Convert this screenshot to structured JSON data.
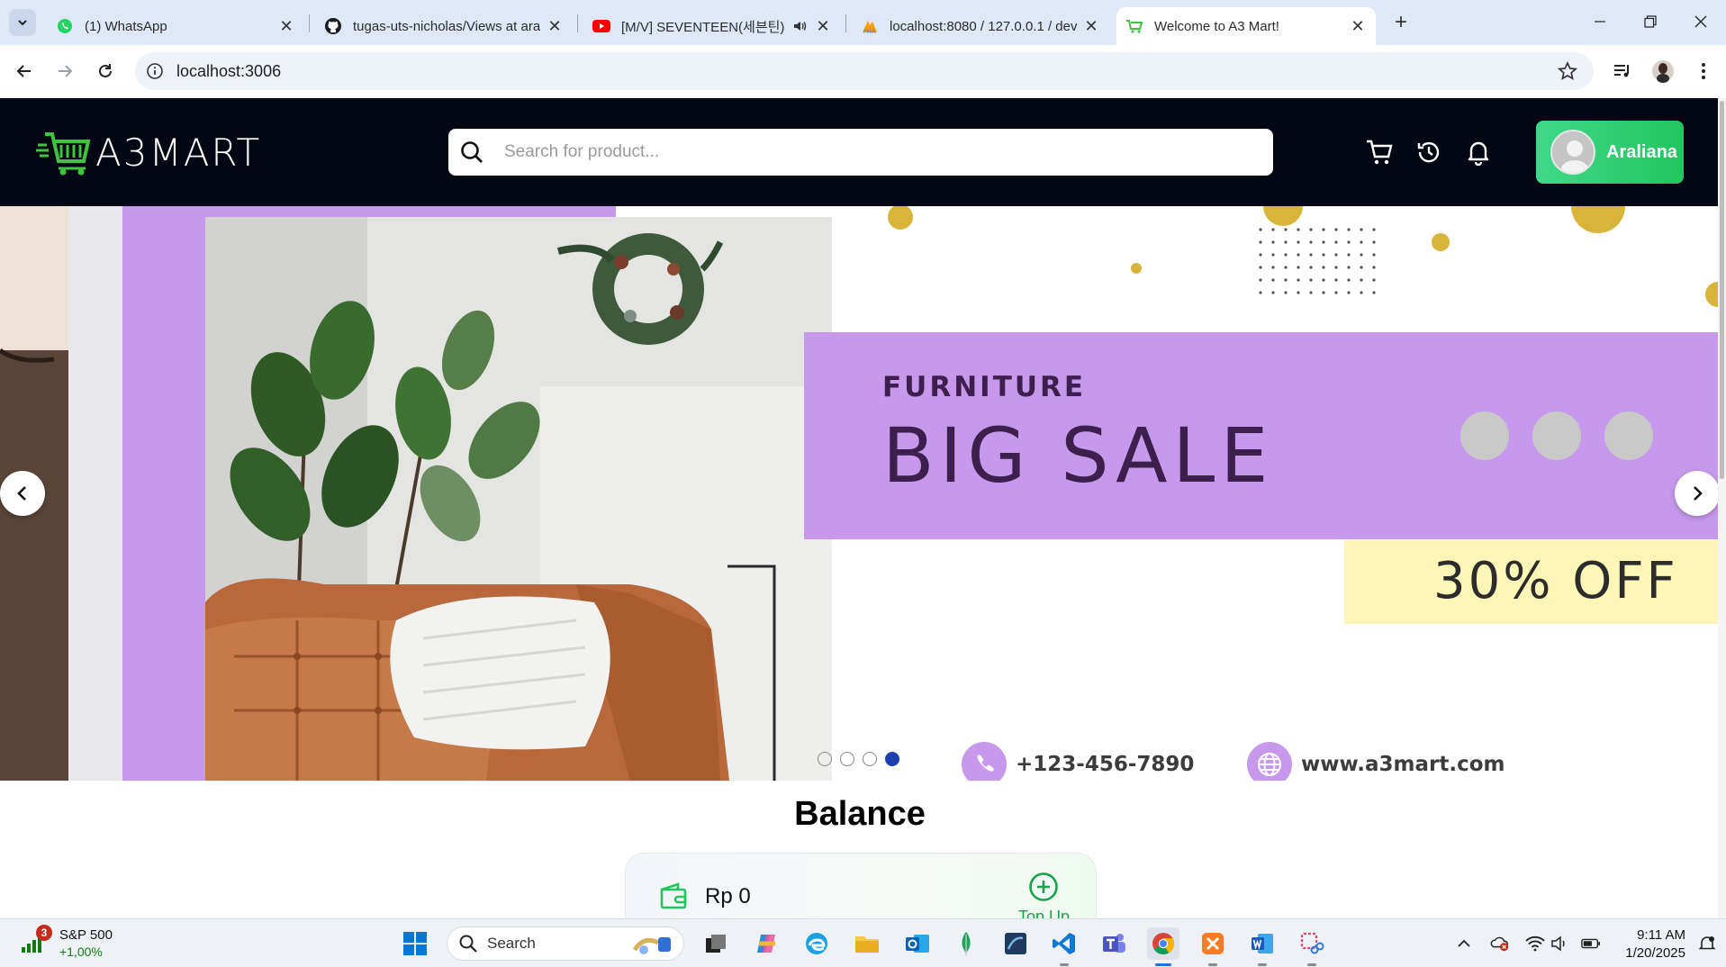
{
  "browser": {
    "tabs": [
      {
        "title": "(1) WhatsApp",
        "icon": "whatsapp-icon"
      },
      {
        "title": "tugas-uts-nicholas/Views at ara",
        "icon": "github-icon"
      },
      {
        "title": "[M/V] SEVENTEEN(세븐틴) -",
        "icon": "youtube-icon"
      },
      {
        "title": "localhost:8080 / 127.0.0.1 / dev",
        "icon": "phpmyadmin-icon"
      },
      {
        "title": "Welcome to A3 Mart!",
        "icon": "a3mart-cart-icon"
      }
    ],
    "active_tab_index": 4,
    "url": "localhost:3006"
  },
  "app": {
    "logo_text": "A3MART",
    "search_placeholder": "Search for product...",
    "user_name": "Araliana",
    "brand_green": "#22c55e",
    "header_bg": "#030714"
  },
  "banner": {
    "furniture_label": "FURNITURE",
    "headline": "BIG SALE",
    "discount": "30% OFF",
    "phone": "+123-456-7890",
    "website": "www.a3mart.com",
    "slide_count": 4,
    "active_slide": 4,
    "accent": "#c798ec"
  },
  "balance": {
    "title": "Balance",
    "amount": "Rp 0",
    "topup_label": "Top Up"
  },
  "taskbar": {
    "stock_name": "S&P 500",
    "stock_change": "+1,00%",
    "notification_count": "3",
    "search_label": "Search",
    "time": "9:11 AM",
    "date": "1/20/2025"
  }
}
